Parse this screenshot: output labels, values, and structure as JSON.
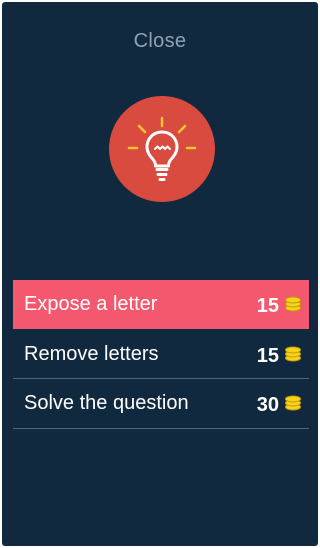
{
  "dialog": {
    "close_label": "Close",
    "icon": "lightbulb-icon"
  },
  "options": [
    {
      "label": "Expose a letter",
      "cost": "15",
      "icon": "coins-icon",
      "selected": true
    },
    {
      "label": "Remove letters",
      "cost": "15",
      "icon": "coins-icon",
      "selected": false
    },
    {
      "label": "Solve the question",
      "cost": "30",
      "icon": "coins-icon",
      "selected": false
    }
  ],
  "colors": {
    "background": "#11293f",
    "hint_circle": "#d84b3e",
    "selected_row": "#f4586e",
    "bulb_rays": "#f7c430",
    "coin": "#f7d31a",
    "close_text": "#8ea2b3"
  }
}
